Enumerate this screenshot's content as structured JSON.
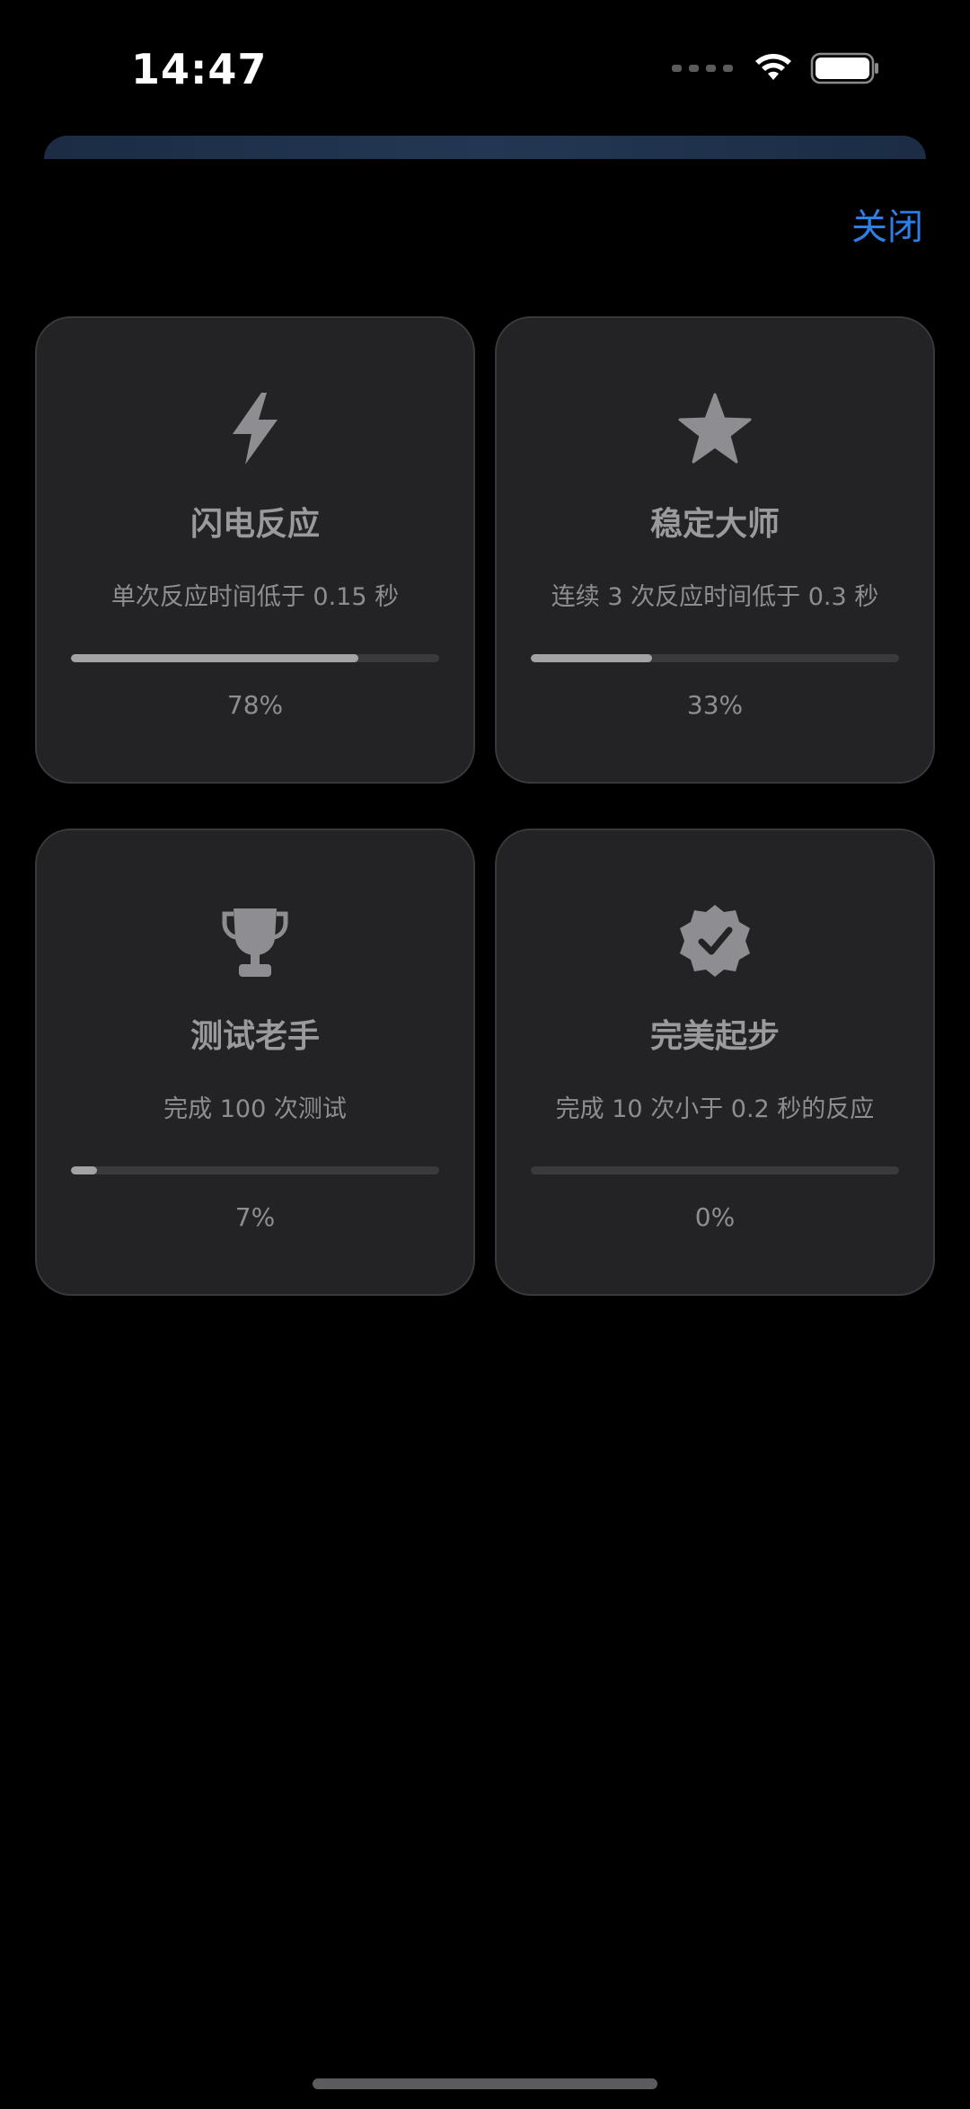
{
  "status_bar": {
    "time": "14:47"
  },
  "header": {
    "close_label": "关闭"
  },
  "colors": {
    "accent": "#2d7fe6",
    "card_bg": "#232325",
    "progress_fill": "#a3a3a6",
    "progress_track": "#3a3a3c"
  },
  "achievements": [
    {
      "icon": "lightning-bolt-icon",
      "title": "闪电反应",
      "description": "单次反应时间低于 0.15 秒",
      "progress": 0.78,
      "percent_label": "78%"
    },
    {
      "icon": "star-icon",
      "title": "稳定大师",
      "description": "连续 3 次反应时间低于 0.3 秒",
      "progress": 0.33,
      "percent_label": "33%"
    },
    {
      "icon": "trophy-icon",
      "title": "测试老手",
      "description": "完成 100 次测试",
      "progress": 0.07,
      "percent_label": "7%"
    },
    {
      "icon": "checkmark-seal-icon",
      "title": "完美起步",
      "description": "完成 10 次小于 0.2 秒的反应",
      "progress": 0.0,
      "percent_label": "0%"
    }
  ]
}
